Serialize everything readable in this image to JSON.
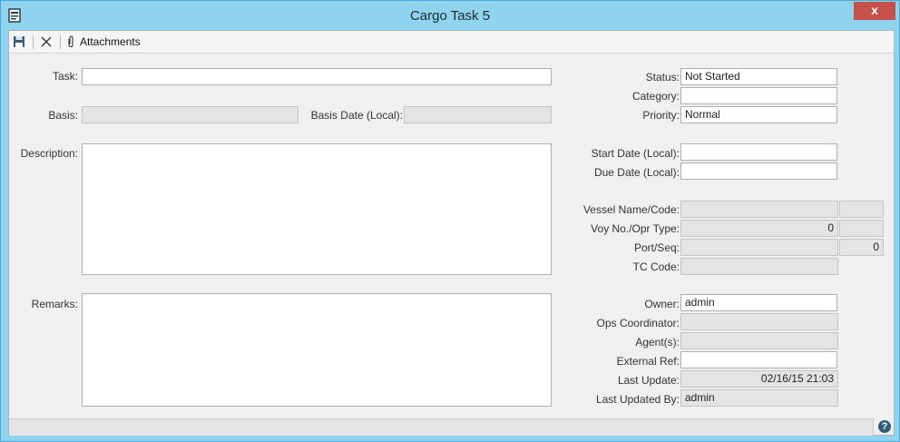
{
  "window": {
    "title": "Cargo Task 5",
    "close_label": "x"
  },
  "toolbar": {
    "attachments_label": "Attachments"
  },
  "left": {
    "task_label": "Task:",
    "task_value": "",
    "basis_label": "Basis:",
    "basis_date_label": "Basis Date (Local):",
    "description_label": "Description:",
    "remarks_label": "Remarks:"
  },
  "right": {
    "status_label": "Status:",
    "status_value": "Not Started",
    "category_label": "Category:",
    "category_value": "",
    "priority_label": "Priority:",
    "priority_value": "Normal",
    "start_date_label": "Start Date (Local):",
    "due_date_label": "Due Date (Local):",
    "vessel_label": "Vessel Name/Code:",
    "voy_label": "Voy No./Opr Type:",
    "voy_value": "0",
    "port_label": "Port/Seq:",
    "port_seq_value": "0",
    "tc_code_label": "TC Code:",
    "owner_label": "Owner:",
    "owner_value": "admin",
    "ops_label": "Ops Coordinator:",
    "agents_label": "Agent(s):",
    "external_ref_label": "External Ref:",
    "last_update_label": "Last Update:",
    "last_update_value": "02/16/15  21:03",
    "last_updated_by_label": "Last Updated By:",
    "last_updated_by_value": "admin"
  },
  "footer": {
    "help_label": "?"
  }
}
